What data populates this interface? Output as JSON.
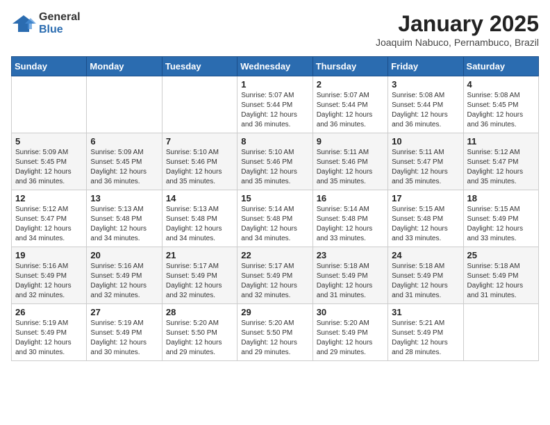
{
  "logo": {
    "general": "General",
    "blue": "Blue"
  },
  "header": {
    "title": "January 2025",
    "subtitle": "Joaquim Nabuco, Pernambuco, Brazil"
  },
  "weekdays": [
    "Sunday",
    "Monday",
    "Tuesday",
    "Wednesday",
    "Thursday",
    "Friday",
    "Saturday"
  ],
  "weeks": [
    [
      {
        "day": "",
        "info": ""
      },
      {
        "day": "",
        "info": ""
      },
      {
        "day": "",
        "info": ""
      },
      {
        "day": "1",
        "info": "Sunrise: 5:07 AM\nSunset: 5:44 PM\nDaylight: 12 hours\nand 36 minutes."
      },
      {
        "day": "2",
        "info": "Sunrise: 5:07 AM\nSunset: 5:44 PM\nDaylight: 12 hours\nand 36 minutes."
      },
      {
        "day": "3",
        "info": "Sunrise: 5:08 AM\nSunset: 5:44 PM\nDaylight: 12 hours\nand 36 minutes."
      },
      {
        "day": "4",
        "info": "Sunrise: 5:08 AM\nSunset: 5:45 PM\nDaylight: 12 hours\nand 36 minutes."
      }
    ],
    [
      {
        "day": "5",
        "info": "Sunrise: 5:09 AM\nSunset: 5:45 PM\nDaylight: 12 hours\nand 36 minutes."
      },
      {
        "day": "6",
        "info": "Sunrise: 5:09 AM\nSunset: 5:45 PM\nDaylight: 12 hours\nand 36 minutes."
      },
      {
        "day": "7",
        "info": "Sunrise: 5:10 AM\nSunset: 5:46 PM\nDaylight: 12 hours\nand 35 minutes."
      },
      {
        "day": "8",
        "info": "Sunrise: 5:10 AM\nSunset: 5:46 PM\nDaylight: 12 hours\nand 35 minutes."
      },
      {
        "day": "9",
        "info": "Sunrise: 5:11 AM\nSunset: 5:46 PM\nDaylight: 12 hours\nand 35 minutes."
      },
      {
        "day": "10",
        "info": "Sunrise: 5:11 AM\nSunset: 5:47 PM\nDaylight: 12 hours\nand 35 minutes."
      },
      {
        "day": "11",
        "info": "Sunrise: 5:12 AM\nSunset: 5:47 PM\nDaylight: 12 hours\nand 35 minutes."
      }
    ],
    [
      {
        "day": "12",
        "info": "Sunrise: 5:12 AM\nSunset: 5:47 PM\nDaylight: 12 hours\nand 34 minutes."
      },
      {
        "day": "13",
        "info": "Sunrise: 5:13 AM\nSunset: 5:48 PM\nDaylight: 12 hours\nand 34 minutes."
      },
      {
        "day": "14",
        "info": "Sunrise: 5:13 AM\nSunset: 5:48 PM\nDaylight: 12 hours\nand 34 minutes."
      },
      {
        "day": "15",
        "info": "Sunrise: 5:14 AM\nSunset: 5:48 PM\nDaylight: 12 hours\nand 34 minutes."
      },
      {
        "day": "16",
        "info": "Sunrise: 5:14 AM\nSunset: 5:48 PM\nDaylight: 12 hours\nand 33 minutes."
      },
      {
        "day": "17",
        "info": "Sunrise: 5:15 AM\nSunset: 5:48 PM\nDaylight: 12 hours\nand 33 minutes."
      },
      {
        "day": "18",
        "info": "Sunrise: 5:15 AM\nSunset: 5:49 PM\nDaylight: 12 hours\nand 33 minutes."
      }
    ],
    [
      {
        "day": "19",
        "info": "Sunrise: 5:16 AM\nSunset: 5:49 PM\nDaylight: 12 hours\nand 32 minutes."
      },
      {
        "day": "20",
        "info": "Sunrise: 5:16 AM\nSunset: 5:49 PM\nDaylight: 12 hours\nand 32 minutes."
      },
      {
        "day": "21",
        "info": "Sunrise: 5:17 AM\nSunset: 5:49 PM\nDaylight: 12 hours\nand 32 minutes."
      },
      {
        "day": "22",
        "info": "Sunrise: 5:17 AM\nSunset: 5:49 PM\nDaylight: 12 hours\nand 32 minutes."
      },
      {
        "day": "23",
        "info": "Sunrise: 5:18 AM\nSunset: 5:49 PM\nDaylight: 12 hours\nand 31 minutes."
      },
      {
        "day": "24",
        "info": "Sunrise: 5:18 AM\nSunset: 5:49 PM\nDaylight: 12 hours\nand 31 minutes."
      },
      {
        "day": "25",
        "info": "Sunrise: 5:18 AM\nSunset: 5:49 PM\nDaylight: 12 hours\nand 31 minutes."
      }
    ],
    [
      {
        "day": "26",
        "info": "Sunrise: 5:19 AM\nSunset: 5:49 PM\nDaylight: 12 hours\nand 30 minutes."
      },
      {
        "day": "27",
        "info": "Sunrise: 5:19 AM\nSunset: 5:49 PM\nDaylight: 12 hours\nand 30 minutes."
      },
      {
        "day": "28",
        "info": "Sunrise: 5:20 AM\nSunset: 5:50 PM\nDaylight: 12 hours\nand 29 minutes."
      },
      {
        "day": "29",
        "info": "Sunrise: 5:20 AM\nSunset: 5:50 PM\nDaylight: 12 hours\nand 29 minutes."
      },
      {
        "day": "30",
        "info": "Sunrise: 5:20 AM\nSunset: 5:49 PM\nDaylight: 12 hours\nand 29 minutes."
      },
      {
        "day": "31",
        "info": "Sunrise: 5:21 AM\nSunset: 5:49 PM\nDaylight: 12 hours\nand 28 minutes."
      },
      {
        "day": "",
        "info": ""
      }
    ]
  ]
}
